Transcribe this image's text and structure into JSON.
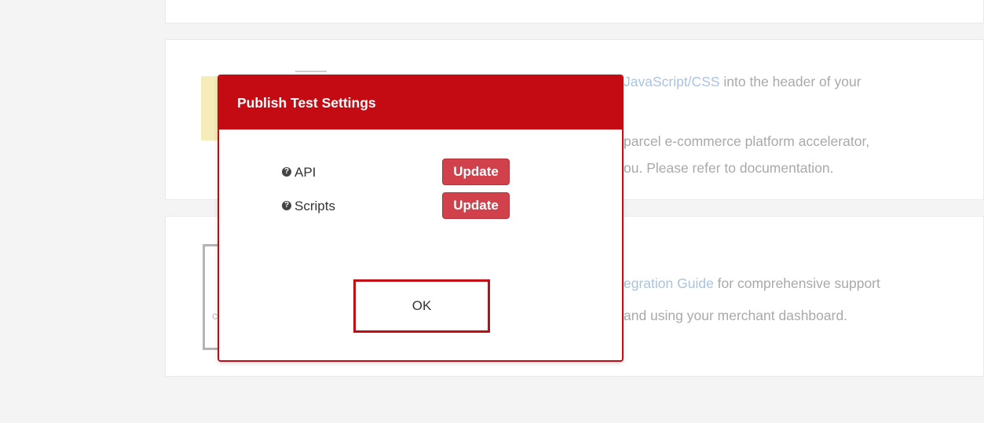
{
  "background": {
    "line1": {
      "link": "JavaScript/CSS",
      "text": " into the header of your"
    },
    "line2": "parcel e-commerce platform accelerator,",
    "line3": "ou. Please refer to documentation.",
    "line4": {
      "link": "egration Guide",
      "text": " for comprehensive support"
    },
    "line5": "and using your merchant dashboard.",
    "frame_letter": "c"
  },
  "modal": {
    "title": "Publish Test Settings",
    "rows": [
      {
        "icon": "question-circle-icon",
        "glyph": "?",
        "label": "API",
        "button": "Update"
      },
      {
        "icon": "question-circle-icon",
        "glyph": "?",
        "label": "Scripts",
        "button": "Update"
      }
    ],
    "ok_label": "OK"
  },
  "colors": {
    "accent": "#c40a12",
    "update_button": "#d0414b",
    "link": "#a8c4e0"
  }
}
